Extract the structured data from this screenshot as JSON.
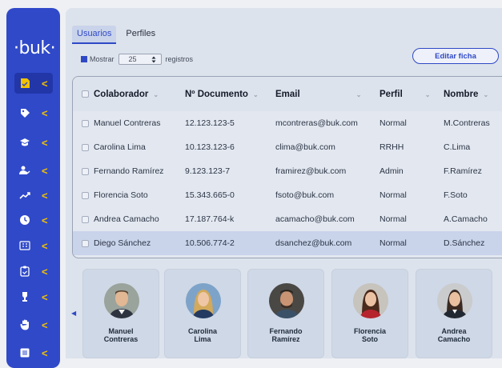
{
  "brand": {
    "logo": "·buk·"
  },
  "sidebar": {
    "items": [
      {
        "icon": "document-icon",
        "active": true
      },
      {
        "icon": "tag-icon",
        "active": false
      },
      {
        "icon": "graduation-cap-icon",
        "active": false
      },
      {
        "icon": "user-check-icon",
        "active": false
      },
      {
        "icon": "trend-up-icon",
        "active": false
      },
      {
        "icon": "clock-icon",
        "active": false
      },
      {
        "icon": "calculator-icon",
        "active": false
      },
      {
        "icon": "clipboard-icon",
        "active": false
      },
      {
        "icon": "trophy-icon",
        "active": false
      },
      {
        "icon": "hand-icon",
        "active": false
      },
      {
        "icon": "list-icon",
        "active": false
      }
    ],
    "chevron": "<"
  },
  "tabs": {
    "usuarios": "Usuarios",
    "perfiles": "Perfiles"
  },
  "controls": {
    "show_label": "Mostrar",
    "page_size": "25",
    "registros_label": "registros",
    "edit_button": "Editar ficha"
  },
  "table": {
    "headers": {
      "colaborador": "Colaborador",
      "documento": "Nº Documento",
      "email": "Email",
      "perfil": "Perfil",
      "nombre": "Nombre"
    },
    "rows": [
      {
        "colaborador": "Manuel Contreras",
        "documento": "12.123.123-5",
        "email": "mcontreras@buk.com",
        "perfil": "Normal",
        "nombre": "M.Contreras"
      },
      {
        "colaborador": "Carolina Lima",
        "documento": "10.123.123-6",
        "email": "clima@buk.com",
        "perfil": "RRHH",
        "nombre": "C.Lima"
      },
      {
        "colaborador": "Fernando Ramírez",
        "documento": "9.123.123-7",
        "email": "framirez@buk.com",
        "perfil": "Admin",
        "nombre": "F.Ramírez"
      },
      {
        "colaborador": "Florencia Soto",
        "documento": "15.343.665-0",
        "email": "fsoto@buk.com",
        "perfil": "Normal",
        "nombre": "F.Soto"
      },
      {
        "colaborador": "Andrea Camacho",
        "documento": "17.187.764-k",
        "email": "acamacho@buk.com",
        "perfil": "Normal",
        "nombre": "A.Camacho"
      },
      {
        "colaborador": "Diego Sánchez",
        "documento": "10.506.774-2",
        "email": "dsanchez@buk.com",
        "perfil": "Normal",
        "nombre": "D.Sánchez"
      }
    ],
    "selected_row": 5
  },
  "cards": [
    {
      "line1": "Manuel",
      "line2": "Contreras"
    },
    {
      "line1": "Carolina",
      "line2": "Lima"
    },
    {
      "line1": "Fernando",
      "line2": "Ramírez"
    },
    {
      "line1": "Florencia",
      "line2": "Soto"
    },
    {
      "line1": "Andrea",
      "line2": "Camacho"
    }
  ],
  "colors": {
    "brand": "#3049c9",
    "accent_chevron": "#f2c200",
    "selected_row": "#c9d3ea"
  }
}
